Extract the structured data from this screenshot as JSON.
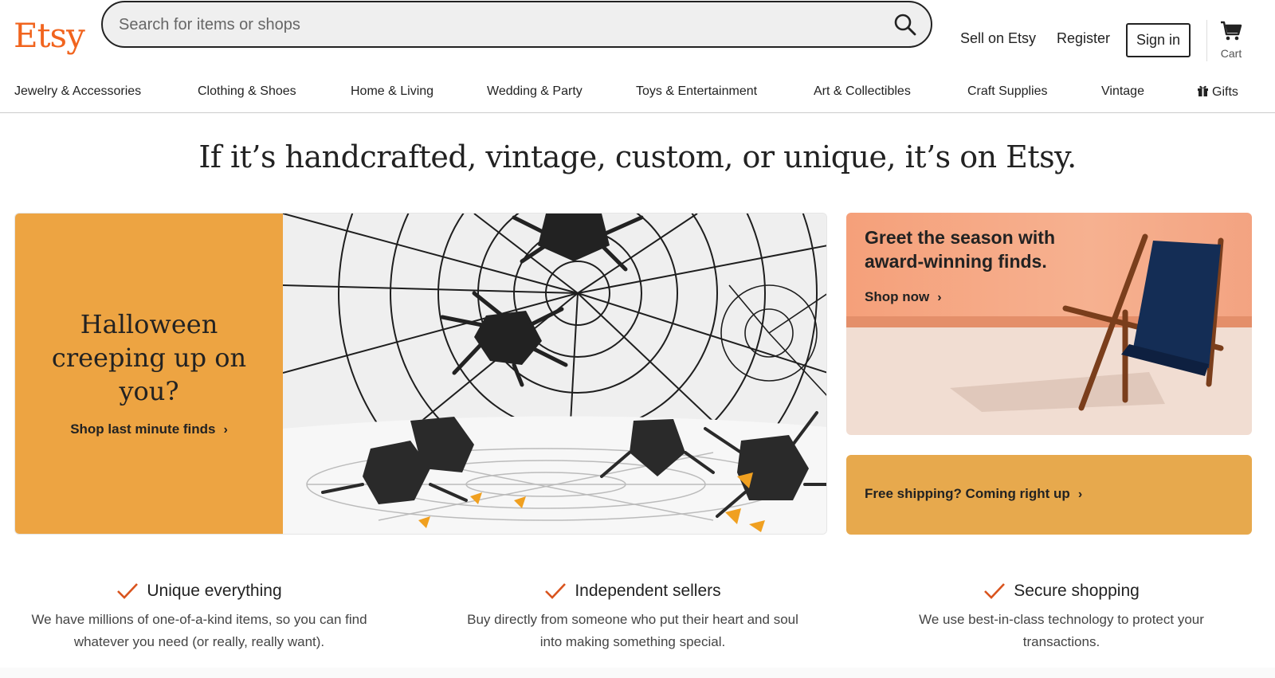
{
  "header": {
    "logo": "Etsy",
    "search_placeholder": "Search for items or shops",
    "sell_label": "Sell on Etsy",
    "register_label": "Register",
    "signin_label": "Sign in",
    "cart_label": "Cart"
  },
  "nav": {
    "items": [
      "Jewelry & Accessories",
      "Clothing & Shoes",
      "Home & Living",
      "Wedding & Party",
      "Toys & Entertainment",
      "Art & Collectibles",
      "Craft Supplies",
      "Vintage",
      "Gifts"
    ]
  },
  "hero": {
    "headline": "If it’s handcrafted, vintage, custom, or unique, it’s on Etsy.",
    "main_promo": {
      "title": "Halloween creeping up on you?",
      "link": "Shop last minute finds"
    },
    "side_promo": {
      "title": "Greet the season with award-winning finds.",
      "link": "Shop now"
    },
    "shipping_promo": {
      "link": "Free shipping? Coming right up"
    }
  },
  "value_props": [
    {
      "title": "Unique everything",
      "desc": "We have millions of one-of-a-kind items, so you can find whatever you need (or really, really want)."
    },
    {
      "title": "Independent sellers",
      "desc": "Buy directly from someone who put their heart and soul into making something special."
    },
    {
      "title": "Secure shopping",
      "desc": "We use best-in-class technology to protect your transactions."
    }
  ],
  "colors": {
    "brand": "#f1641e",
    "promo_orange": "#eda442",
    "promo_gold": "#e7a94d",
    "check": "#d9541e"
  },
  "icons": {
    "search": "search-icon",
    "cart": "cart-icon",
    "gift": "gift-icon",
    "chevron": "chevron-right-icon",
    "check": "check-icon"
  }
}
